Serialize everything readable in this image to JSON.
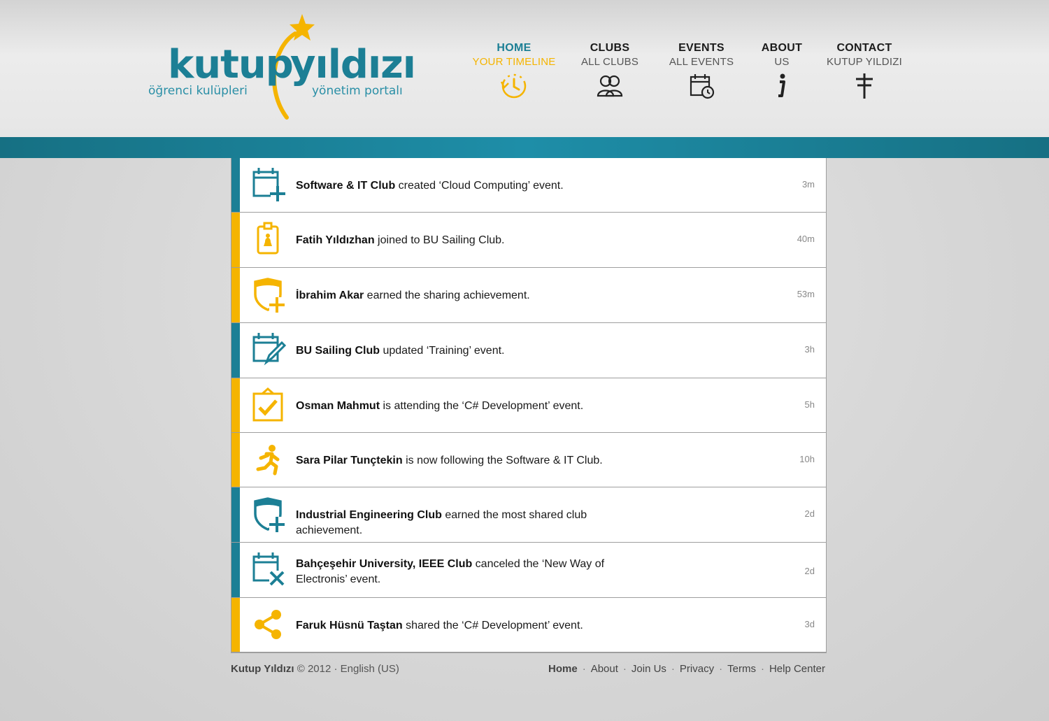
{
  "brand": {
    "name_part1": "kutup",
    "name_part2": "yıldızı",
    "tagline_left": "öğrenci kulüpleri",
    "tagline_right": "yönetim portalı",
    "colors": {
      "primary": "#1c7f95",
      "accent": "#f5b400"
    }
  },
  "nav": [
    {
      "title": "HOME",
      "subtitle": "YOUR TIMELINE",
      "icon": "timeline-clock-icon",
      "active": true
    },
    {
      "title": "CLUBS",
      "subtitle": "ALL CLUBS",
      "icon": "people-icon",
      "active": false
    },
    {
      "title": "EVENTS",
      "subtitle": "ALL EVENTS",
      "icon": "calendar-clock-icon",
      "active": false
    },
    {
      "title": "ABOUT",
      "subtitle": "US",
      "icon": "info-icon",
      "active": false
    },
    {
      "title": "CONTACT",
      "subtitle": "KUTUP YILDIZI",
      "icon": "signpost-icon",
      "active": false
    }
  ],
  "feed": [
    {
      "actor": "Software & IT Club",
      "text": " created ‘Cloud Computing’ event.",
      "time": "3m",
      "kind": "club",
      "icon": "calendar-add-icon"
    },
    {
      "actor": "Fatih Yıldızhan",
      "text": " joined to BU Sailing Club.",
      "time": "40m",
      "kind": "user",
      "icon": "badge-join-icon"
    },
    {
      "actor": "İbrahim Akar",
      "text": " earned the sharing achievement.",
      "time": "53m",
      "kind": "user",
      "icon": "shield-plus-icon"
    },
    {
      "actor": "BU Sailing Club",
      "text": " updated ‘Training’ event.",
      "time": "3h",
      "kind": "club",
      "icon": "calendar-edit-icon"
    },
    {
      "actor": "Osman Mahmut",
      "text": " is attending the ‘C# Development’ event.",
      "time": "5h",
      "kind": "user",
      "icon": "clipboard-check-icon"
    },
    {
      "actor": "Sara Pilar Tunçtekin",
      "text": " is now following the Software & IT Club.",
      "time": "10h",
      "kind": "user",
      "icon": "running-person-icon"
    },
    {
      "actor": "Industrial Engineering Club",
      "text": " earned the most shared club achievement.",
      "time": "2d",
      "kind": "club",
      "icon": "shield-plus-icon"
    },
    {
      "actor": "Bahçeşehir University, IEEE Club",
      "text": " canceled the ‘New Way of Electronis’ event.",
      "time": "2d",
      "kind": "club",
      "icon": "calendar-cancel-icon"
    },
    {
      "actor": "Faruk Hüsnü Taştan",
      "text": " shared the ‘C# Development’ event.",
      "time": "3d",
      "kind": "user",
      "icon": "share-icon"
    }
  ],
  "footer": {
    "brand": "Kutup Yıldızı",
    "copyright": " © 2012 · English (US)",
    "links": [
      "Home",
      "About",
      "Join Us",
      "Privacy",
      "Terms",
      "Help Center"
    ]
  }
}
